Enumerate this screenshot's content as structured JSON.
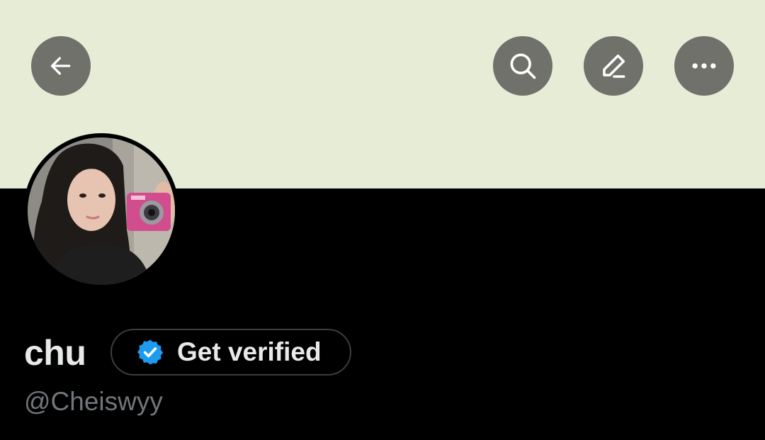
{
  "profile": {
    "display_name": "chu",
    "handle": "@Cheiswyy",
    "verify_button_label": "Get verified"
  },
  "header": {
    "banner_color": "#e6ecd5",
    "buttons": [
      {
        "icon": "arrow-left-icon",
        "action": "back"
      },
      {
        "icon": "search-icon",
        "action": "search"
      },
      {
        "icon": "pencil-icon",
        "action": "edit"
      },
      {
        "icon": "more-horizontal-icon",
        "action": "more"
      }
    ]
  },
  "colors": {
    "background": "#000000",
    "verified_badge": "#1d9bf0",
    "handle_text": "#71767b",
    "primary_text": "#e7e9ea"
  }
}
